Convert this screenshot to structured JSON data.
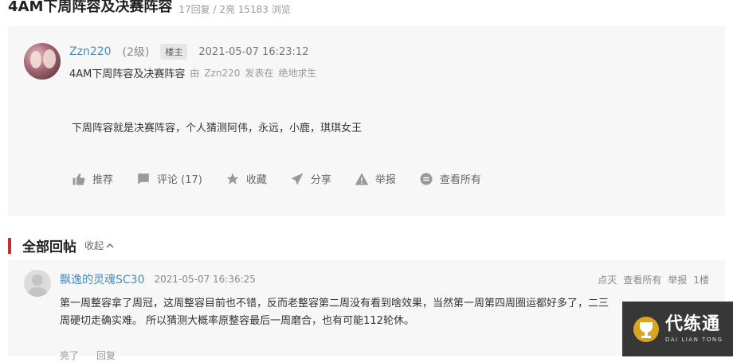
{
  "thread": {
    "title": "4AM下周阵容及决赛阵容",
    "stats": "17回复 / 2亮 15183 浏览"
  },
  "post": {
    "username": "Zzn220",
    "level": "(2级)",
    "badge": "楼主",
    "time": "2021-05-07 16:23:12",
    "sub_title": "4AM下周阵容及决赛阵容",
    "sub_by": "由",
    "sub_author": "Zzn220",
    "sub_posted_in": "发表在",
    "sub_forum": "绝地求生",
    "content": "下周阵容就是决赛阵容，个人猜测阿伟，永远，小鹿，琪琪女王",
    "actions": [
      {
        "label": "推荐",
        "icon": "thumbs-up-icon"
      },
      {
        "label": "评论 (17)",
        "icon": "comment-icon"
      },
      {
        "label": "收藏",
        "icon": "star-icon"
      },
      {
        "label": "分享",
        "icon": "share-icon"
      },
      {
        "label": "举报",
        "icon": "warning-icon"
      },
      {
        "label": "查看所有",
        "icon": "view-all-icon"
      }
    ]
  },
  "replies": {
    "title": "全部回帖",
    "collapse": "收起",
    "items": [
      {
        "username": "飘逸的灵魂SC30",
        "time": "2021-05-07 16:36:25",
        "links": [
          "点灭",
          "查看所有",
          "举报",
          "1楼"
        ],
        "text": "第一周整容拿了周冠，这周整容目前也不错，反而老整容第二周没有看到啥效果，当然第一周第四周圈运都好多了，二三周硬切走确实难。 所以猜测大概率原整容最后一周磨合，也有可能112轮休。",
        "actions": [
          "亮了",
          "回复"
        ]
      }
    ]
  },
  "watermark": {
    "cn": "代练通",
    "en": "DAI LIAN TONG"
  },
  "colors": {
    "accent_red": "#c8302e",
    "link_blue": "#4a8bc2",
    "panel_bg": "#f7f7f7"
  }
}
